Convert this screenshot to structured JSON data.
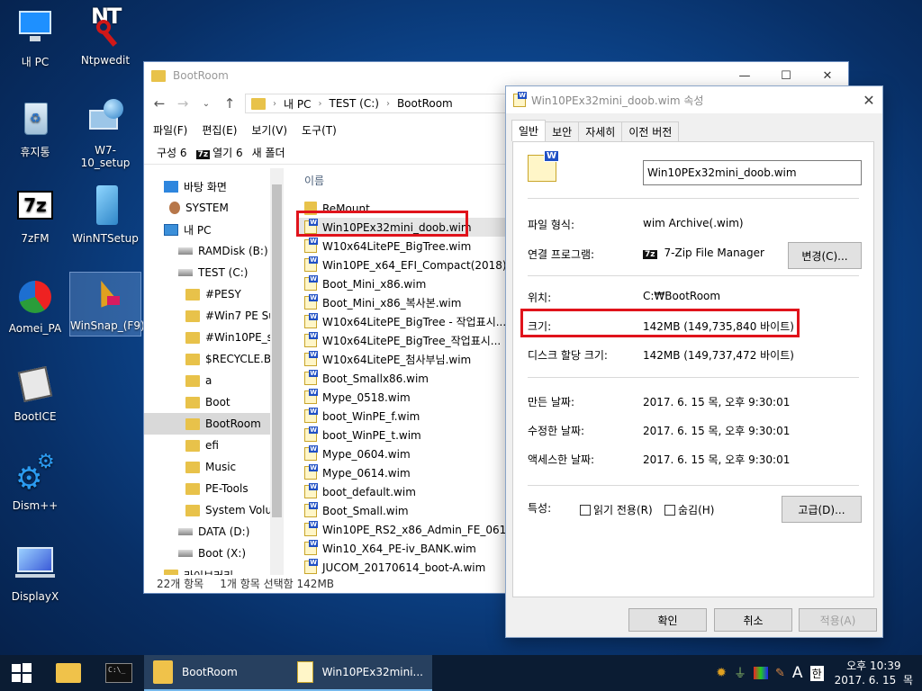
{
  "desktop": {
    "icons": [
      {
        "label": "내 PC"
      },
      {
        "label": "Ntpwedit"
      },
      {
        "label": "휴지통"
      },
      {
        "label": "W7-10_setup"
      },
      {
        "label": "7zFM"
      },
      {
        "label": "WinNTSetup"
      },
      {
        "label": "Aomei_PA"
      },
      {
        "label": "WinSnap_(F9)"
      },
      {
        "label": "BootICE"
      },
      {
        "label": "Dism++"
      },
      {
        "label": "DisplayX"
      }
    ]
  },
  "explorer": {
    "title": "BootRoom",
    "address": [
      "내 PC",
      "TEST (C:)",
      "BootRoom"
    ],
    "menu": [
      "파일(F)",
      "편집(E)",
      "보기(V)",
      "도구(T)"
    ],
    "toolbar": {
      "organize": "구성",
      "organize_arrow": "6",
      "open": "열기",
      "open_arrow": "6",
      "new_folder": "새 폴더"
    },
    "nav": [
      {
        "label": "바탕 화면",
        "icon": "desktop"
      },
      {
        "label": "SYSTEM",
        "icon": "user"
      },
      {
        "label": "내 PC",
        "icon": "pc"
      },
      {
        "label": "RAMDisk (B:)",
        "icon": "drive"
      },
      {
        "label": "TEST (C:)",
        "icon": "drive"
      },
      {
        "label": "#PESY",
        "icon": "folder"
      },
      {
        "label": "#Win7 PE Su",
        "icon": "folder"
      },
      {
        "label": "#Win10PE_sv",
        "icon": "folder"
      },
      {
        "label": "$RECYCLE.BI",
        "icon": "folder"
      },
      {
        "label": "a",
        "icon": "folder"
      },
      {
        "label": "Boot",
        "icon": "folder"
      },
      {
        "label": "BootRoom",
        "icon": "folder"
      },
      {
        "label": "efi",
        "icon": "folder"
      },
      {
        "label": "Music",
        "icon": "folder"
      },
      {
        "label": "PE-Tools",
        "icon": "folder"
      },
      {
        "label": "System Volu",
        "icon": "folder"
      },
      {
        "label": "DATA (D:)",
        "icon": "drive"
      },
      {
        "label": "Boot (X:)",
        "icon": "drive"
      },
      {
        "label": "라이브러리",
        "icon": "folder"
      }
    ],
    "column_name": "이름",
    "files": [
      {
        "name": "ReMount",
        "type": "folder"
      },
      {
        "name": "Win10PEx32mini_doob.wim",
        "type": "wim"
      },
      {
        "name": "W10x64LitePE_BigTree.wim",
        "type": "wim"
      },
      {
        "name": "Win10PE_x64_EFI_Compact(2018)...",
        "type": "wim"
      },
      {
        "name": "Boot_Mini_x86.wim",
        "type": "wim"
      },
      {
        "name": "Boot_Mini_x86_복사본.wim",
        "type": "wim"
      },
      {
        "name": "W10x64LitePE_BigTree - 작업표시...",
        "type": "wim"
      },
      {
        "name": "W10x64LitePE_BigTree_작업표시...",
        "type": "wim"
      },
      {
        "name": "W10x64LitePE_첨사부님.wim",
        "type": "wim"
      },
      {
        "name": "Boot_Smallx86.wim",
        "type": "wim"
      },
      {
        "name": "Mype_0518.wim",
        "type": "wim"
      },
      {
        "name": "boot_WinPE_f.wim",
        "type": "wim"
      },
      {
        "name": "boot_WinPE_t.wim",
        "type": "wim"
      },
      {
        "name": "Mype_0604.wim",
        "type": "wim"
      },
      {
        "name": "Mype_0614.wim",
        "type": "wim"
      },
      {
        "name": "boot_default.wim",
        "type": "wim"
      },
      {
        "name": "Boot_Small.wim",
        "type": "wim"
      },
      {
        "name": "Win10PE_RS2_x86_Admin_FE_061...",
        "type": "wim"
      },
      {
        "name": "Win10_X64_PE-iv_BANK.wim",
        "type": "wim"
      },
      {
        "name": "JUCOM_20170614_boot-A.wim",
        "type": "wim"
      }
    ],
    "status": {
      "count": "22개 항목",
      "selection": "1개 항목 선택함 142MB"
    }
  },
  "properties": {
    "title": "Win10PEx32mini_doob.wim 속성",
    "tabs": [
      "일반",
      "보안",
      "자세히",
      "이전 버전"
    ],
    "filename": "Win10PEx32mini_doob.wim",
    "file_type_label": "파일 형식:",
    "file_type": "wim Archive(.wim)",
    "opens_with_label": "연결 프로그램:",
    "opens_with": "7-Zip File Manager",
    "change_button": "변경(C)...",
    "location_label": "위치:",
    "location": "C:₩BootRoom",
    "size_label": "크기:",
    "size": "142MB (149,735,840 바이트)",
    "disk_size_label": "디스크 할당 크기:",
    "disk_size": "142MB (149,737,472 바이트)",
    "created_label": "만든 날짜:",
    "created": "2017. 6. 15 목, 오후 9:30:01",
    "modified_label": "수정한 날짜:",
    "modified": "2017. 6. 15 목, 오후 9:30:01",
    "accessed_label": "액세스한 날짜:",
    "accessed": "2017. 6. 15 목, 오후 9:30:01",
    "attributes_label": "특성:",
    "readonly_label": "읽기 전용(R)",
    "hidden_label": "숨김(H)",
    "advanced_button": "고급(D)...",
    "ok_button": "확인",
    "cancel_button": "취소",
    "apply_button": "적용(A)"
  },
  "taskbar": {
    "apps": [
      {
        "label": "BootRoom"
      },
      {
        "label": "Win10PEx32mini..."
      }
    ],
    "ime": "A",
    "ime_lang": "한",
    "clock_time": "오후 10:39",
    "clock_date": "2017. 6. 15",
    "clock_day": "목"
  },
  "colors": {
    "highlight_box": "#e0131b",
    "taskbar": "#0b1c33"
  }
}
